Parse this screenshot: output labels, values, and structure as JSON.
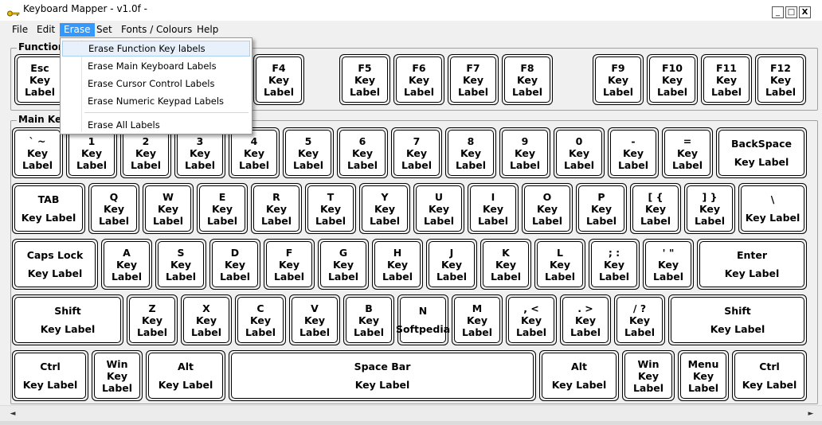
{
  "window": {
    "title": "Keyboard Mapper - v1.0f  -",
    "minimize_label": "_",
    "maximize_label": "□",
    "close_label": "X"
  },
  "menu": [
    "File",
    "Edit",
    "Erase",
    "Set",
    "Fonts / Colours",
    "Help"
  ],
  "groups": {
    "function_label": "Function",
    "main_label": "Main Ke"
  },
  "erase_menu": {
    "items": [
      "Erase Function Key labels",
      "Erase Main Keyboard Labels",
      "Erase Cursor Control Labels",
      "Erase Numeric Keypad Labels",
      "Erase All Labels"
    ]
  },
  "keys": {
    "function_row": [
      [
        "Esc",
        "Key",
        "Label"
      ],
      [
        "F4",
        "Key",
        "Label"
      ],
      [
        "F5",
        "Key",
        "Label"
      ],
      [
        "F6",
        "Key",
        "Label"
      ],
      [
        "F7",
        "Key",
        "Label"
      ],
      [
        "F8",
        "Key",
        "Label"
      ],
      [
        "F9",
        "Key",
        "Label"
      ],
      [
        "F10",
        "Key",
        "Label"
      ],
      [
        "F11",
        "Key",
        "Label"
      ],
      [
        "F12",
        "Key",
        "Label"
      ]
    ],
    "row1": [
      [
        "` ~",
        "Key",
        "Label"
      ],
      [
        "1",
        "Key",
        "Label"
      ],
      [
        "2",
        "Key",
        "Label"
      ],
      [
        "3",
        "Key",
        "Label"
      ],
      [
        "4",
        "Key",
        "Label"
      ],
      [
        "5",
        "Key",
        "Label"
      ],
      [
        "6",
        "Key",
        "Label"
      ],
      [
        "7",
        "Key",
        "Label"
      ],
      [
        "8",
        "Key",
        "Label"
      ],
      [
        "9",
        "Key",
        "Label"
      ],
      [
        "0",
        "Key",
        "Label"
      ],
      [
        "-",
        "Key",
        "Label"
      ],
      [
        "=",
        "Key",
        "Label"
      ],
      [
        "BackSpace",
        "Key Label"
      ]
    ],
    "row2": [
      [
        "TAB",
        "Key Label"
      ],
      [
        "Q",
        "Key",
        "Label"
      ],
      [
        "W",
        "Key",
        "Label"
      ],
      [
        "E",
        "Key",
        "Label"
      ],
      [
        "R",
        "Key",
        "Label"
      ],
      [
        "T",
        "Key",
        "Label"
      ],
      [
        "Y",
        "Key",
        "Label"
      ],
      [
        "U",
        "Key",
        "Label"
      ],
      [
        "I",
        "Key",
        "Label"
      ],
      [
        "O",
        "Key",
        "Label"
      ],
      [
        "P",
        "Key",
        "Label"
      ],
      [
        "[ {",
        "Key",
        "Label"
      ],
      [
        "] }",
        "Key",
        "Label"
      ],
      [
        "\\",
        "Key Label"
      ]
    ],
    "row3": [
      [
        "Caps Lock",
        "Key Label"
      ],
      [
        "A",
        "Key",
        "Label"
      ],
      [
        "S",
        "Key",
        "Label"
      ],
      [
        "D",
        "Key",
        "Label"
      ],
      [
        "F",
        "Key",
        "Label"
      ],
      [
        "G",
        "Key",
        "Label"
      ],
      [
        "H",
        "Key",
        "Label"
      ],
      [
        "J",
        "Key",
        "Label"
      ],
      [
        "K",
        "Key",
        "Label"
      ],
      [
        "L",
        "Key",
        "Label"
      ],
      [
        "; :",
        "Key",
        "Label"
      ],
      [
        "' \"",
        "Key",
        "Label"
      ],
      [
        "Enter",
        "Key Label"
      ]
    ],
    "row4": [
      [
        "Shift",
        "Key Label"
      ],
      [
        "Z",
        "Key",
        "Label"
      ],
      [
        "X",
        "Key",
        "Label"
      ],
      [
        "C",
        "Key",
        "Label"
      ],
      [
        "V",
        "Key",
        "Label"
      ],
      [
        "B",
        "Key",
        "Label"
      ],
      [
        "N",
        "Softpedia"
      ],
      [
        "M",
        "Key",
        "Label"
      ],
      [
        ", <",
        "Key",
        "Label"
      ],
      [
        ". >",
        "Key",
        "Label"
      ],
      [
        "/ ?",
        "Key",
        "Label"
      ],
      [
        "Shift",
        "Key Label"
      ]
    ],
    "row5": [
      [
        "Ctrl",
        "Key Label"
      ],
      [
        "Win",
        "Key",
        "Label"
      ],
      [
        "Alt",
        "Key Label"
      ],
      [
        "Space Bar",
        "Key Label"
      ],
      [
        "Alt",
        "Key Label"
      ],
      [
        "Win",
        "Key",
        "Label"
      ],
      [
        "Menu",
        "Key",
        "Label"
      ],
      [
        "Ctrl",
        "Key Label"
      ]
    ]
  },
  "scrollbar": {
    "left_arrow": "◄",
    "right_arrow": "►"
  }
}
